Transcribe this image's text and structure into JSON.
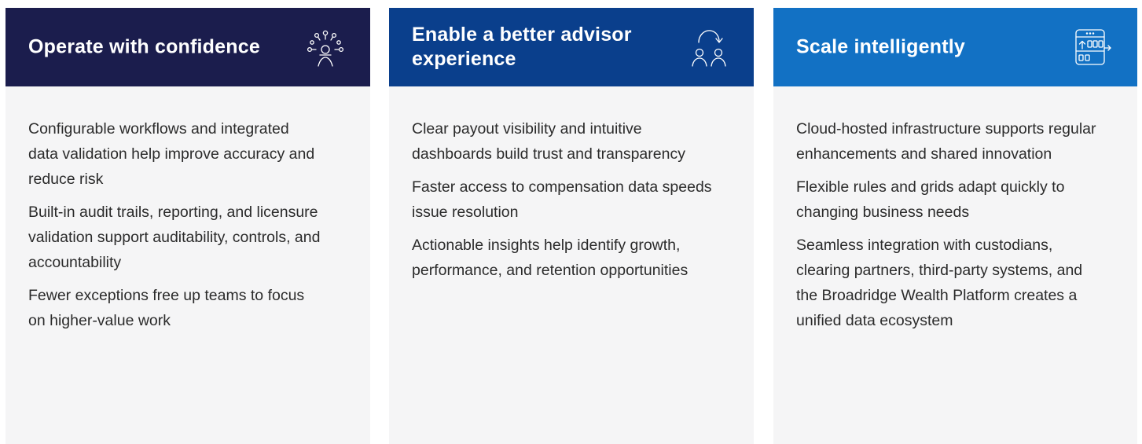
{
  "cards": [
    {
      "title": "Operate with confidence",
      "icon": "network-person-icon",
      "header_color": "#1b1d4d",
      "bullets": [
        "Configurable workflows and integrated data validation help improve accuracy and reduce risk",
        "Built-in audit trails, reporting, and licensure validation support auditability, controls, and accountability",
        "Fewer exceptions free up teams to focus on higher-value work"
      ]
    },
    {
      "title": "Enable a better advisor experience",
      "icon": "people-exchange-icon",
      "header_color": "#0a3f8c",
      "bullets": [
        "Clear payout visibility and intuitive dashboards build trust and transparency",
        "Faster access to compensation data speeds issue resolution",
        "Actionable insights help identify growth, performance, and retention opportunities"
      ]
    },
    {
      "title": "Scale intelligently",
      "icon": "cloud-window-scale-icon",
      "header_color": "#1271c4",
      "bullets": [
        "Cloud-hosted infrastructure supports regular enhancements and shared innovation",
        "Flexible rules and grids adapt quickly to changing business needs",
        "Seamless integration with custodians, clearing partners, third-party systems, and the Broadridge Wealth Platform creates a unified data ecosystem"
      ]
    }
  ]
}
